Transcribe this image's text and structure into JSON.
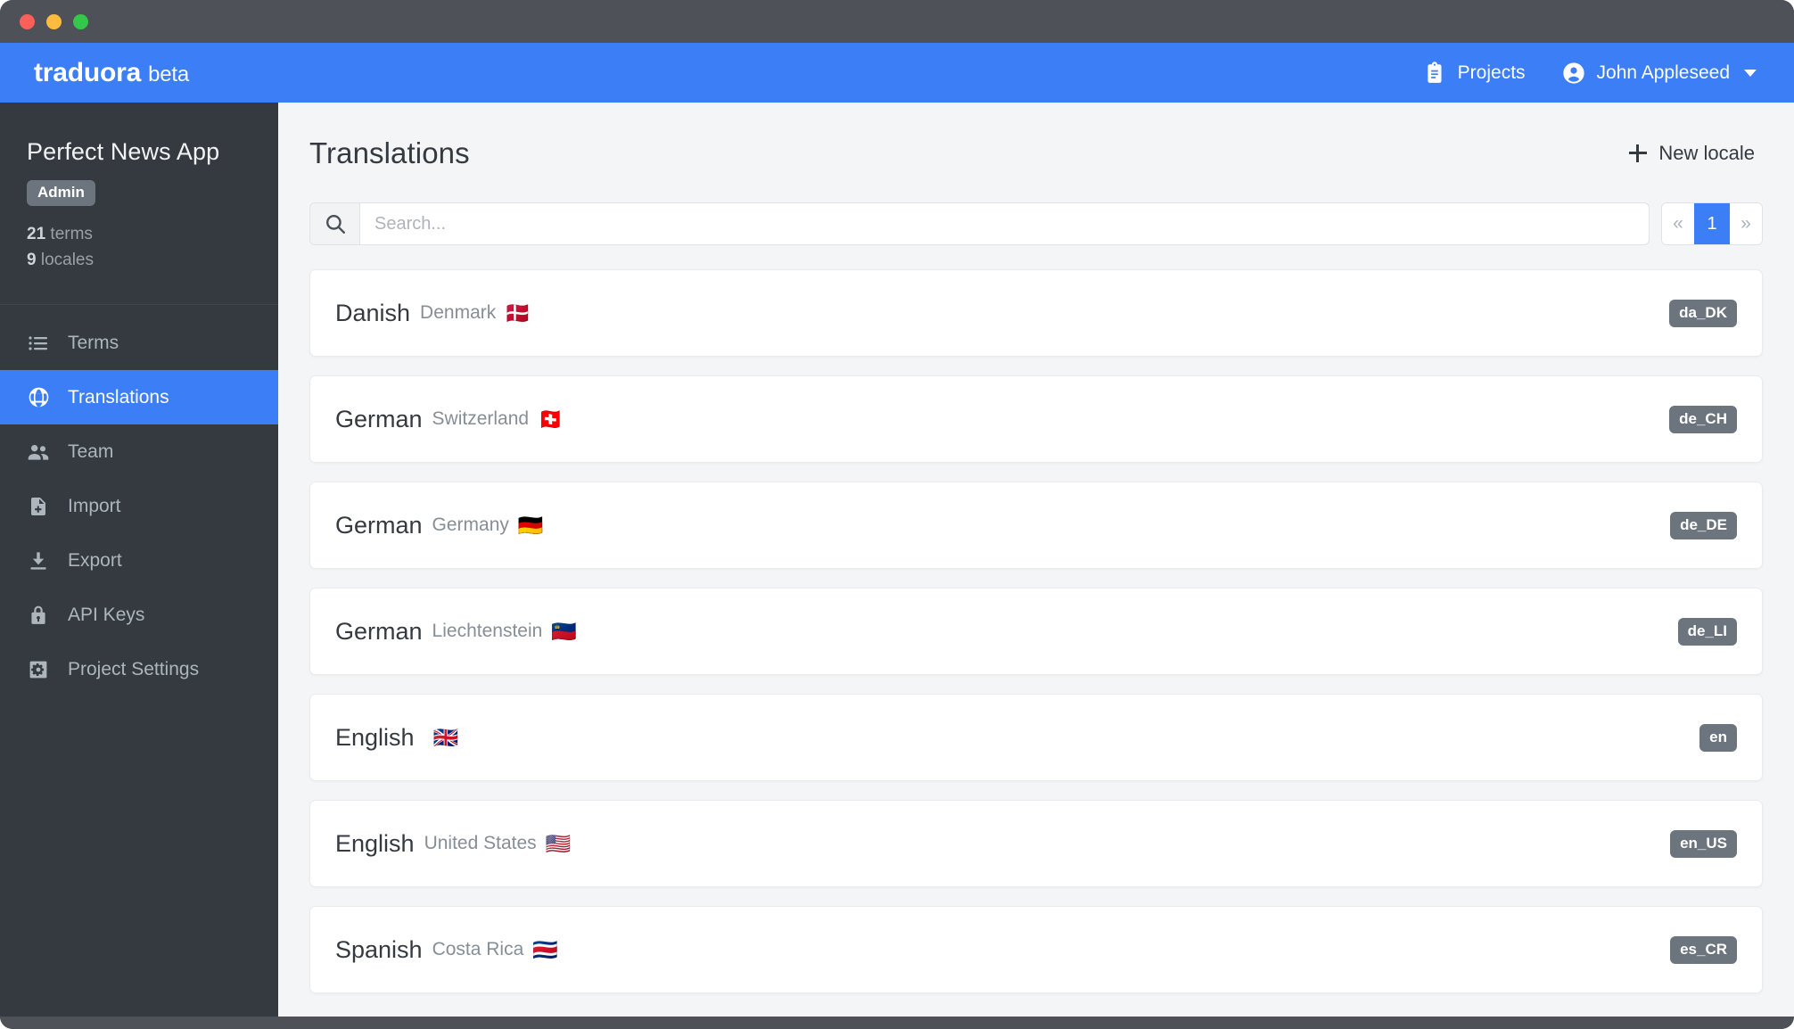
{
  "window": {
    "traffic_lights": [
      "close-red",
      "minimize-yellow",
      "maximize-green"
    ]
  },
  "topbar": {
    "brand_name": "traduora",
    "brand_suffix": "beta",
    "projects_label": "Projects",
    "user_name": "John Appleseed",
    "background_color": "#3b7ef5"
  },
  "sidebar": {
    "project_name": "Perfect News App",
    "role_badge": "Admin",
    "terms_count": "21",
    "terms_label": "terms",
    "locales_count": "9",
    "locales_label": "locales",
    "background_color": "#343a40",
    "active_color": "#3b7ef5",
    "items": [
      {
        "label": "Terms",
        "icon": "list-icon",
        "active": false
      },
      {
        "label": "Translations",
        "icon": "globe-icon",
        "active": true
      },
      {
        "label": "Team",
        "icon": "people-icon",
        "active": false
      },
      {
        "label": "Import",
        "icon": "file-plus-icon",
        "active": false
      },
      {
        "label": "Export",
        "icon": "download-icon",
        "active": false
      },
      {
        "label": "API Keys",
        "icon": "lock-icon",
        "active": false
      },
      {
        "label": "Project Settings",
        "icon": "gear-icon",
        "active": false
      }
    ]
  },
  "main": {
    "page_title": "Translations",
    "new_locale_label": "New locale",
    "search": {
      "placeholder": "Search...",
      "value": ""
    },
    "pagination": {
      "prev_label": "«",
      "next_label": "»",
      "current_page": "1"
    },
    "locales": [
      {
        "language": "Danish",
        "country": "Denmark",
        "flag": "🇩🇰",
        "code": "da_DK"
      },
      {
        "language": "German",
        "country": "Switzerland",
        "flag": "🇨🇭",
        "code": "de_CH"
      },
      {
        "language": "German",
        "country": "Germany",
        "flag": "🇩🇪",
        "code": "de_DE"
      },
      {
        "language": "German",
        "country": "Liechtenstein",
        "flag": "🇱🇮",
        "code": "de_LI"
      },
      {
        "language": "English",
        "country": "",
        "flag": "🇬🇧",
        "code": "en"
      },
      {
        "language": "English",
        "country": "United States",
        "flag": "🇺🇸",
        "code": "en_US"
      },
      {
        "language": "Spanish",
        "country": "Costa Rica",
        "flag": "🇨🇷",
        "code": "es_CR"
      }
    ]
  }
}
